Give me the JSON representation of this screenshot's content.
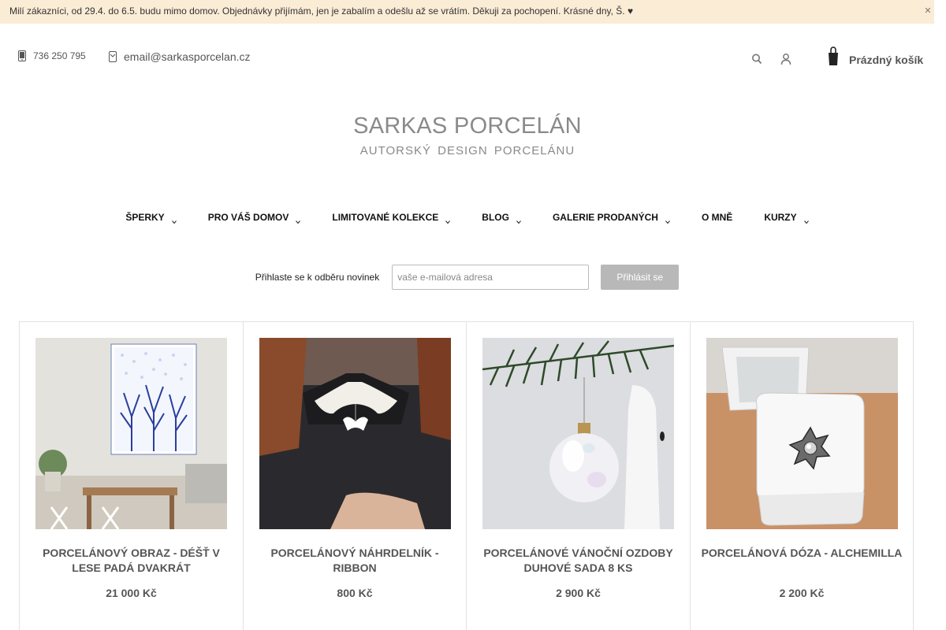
{
  "notice": {
    "text": "Milí zákazníci, od 29.4. do 6.5. budu mimo domov. Objednávky přijímám, jen je zabalím a odešlu až se vrátím. Děkuji za pochopení. Krásné dny, Š. ♥",
    "close_icon": "close-icon"
  },
  "header": {
    "phone": "736 250 795",
    "email": "email@sarkasporcelan.cz",
    "cart_label": "Prázdný košík",
    "icons": [
      "phone-icon",
      "email-icon",
      "search-icon",
      "user-icon",
      "cart-icon"
    ]
  },
  "logo": {
    "title": "SARKAS PORCELÁN",
    "subtitle": "AUTORSKÝ DESIGN PORCELÁNU"
  },
  "nav": {
    "items": [
      {
        "label": "ŠPERKY",
        "has_submenu": true
      },
      {
        "label": "PRO VÁŠ DOMOV",
        "has_submenu": true
      },
      {
        "label": "LIMITOVANÉ KOLEKCE",
        "has_submenu": true
      },
      {
        "label": "BLOG",
        "has_submenu": true
      },
      {
        "label": "GALERIE PRODANÝCH",
        "has_submenu": true
      },
      {
        "label": "O MNĚ",
        "has_submenu": false
      },
      {
        "label": "KURZY",
        "has_submenu": true
      }
    ]
  },
  "newsletter": {
    "label": "Přihlaste se k odběru novinek",
    "placeholder": "vaše e-mailová adresa",
    "button": "Přihlásit se"
  },
  "products": [
    {
      "name": "PORCELÁNOVÝ OBRAZ - DÉŠŤ V LESE PADÁ DVAKRÁT",
      "price": "21 000 Kč"
    },
    {
      "name": "PORCELÁNOVÝ NÁHRDELNÍK - RIBBON",
      "price": "800 Kč"
    },
    {
      "name": "PORCELÁNOVÉ VÁNOČNÍ OZDOBY DUHOVÉ SADA 8 KS",
      "price": "2 900 Kč"
    },
    {
      "name": "PORCELÁNOVÁ DÓZA - ALCHEMILLA",
      "price": "2 200 Kč"
    }
  ],
  "colors": {
    "notice_bg": "#fbecd6",
    "button_bg": "#b8b8b8",
    "logo_text": "#8a8a8a",
    "product_text": "#555555"
  }
}
